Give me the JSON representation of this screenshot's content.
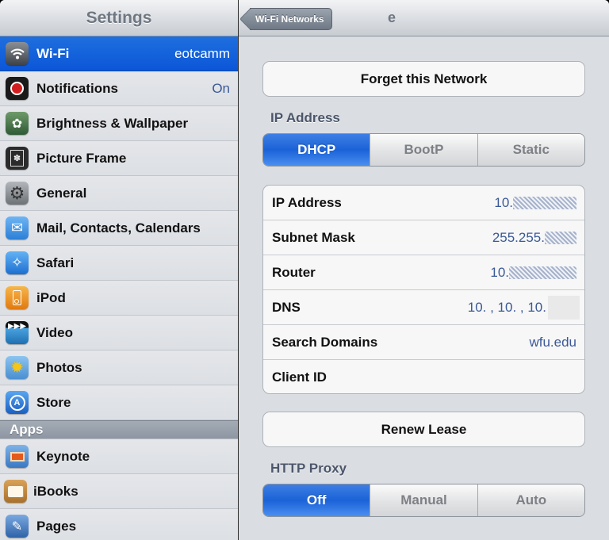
{
  "sidebar": {
    "title": "Settings",
    "items": [
      {
        "label": "Wi-Fi",
        "value": "eotcamm",
        "icon": "wifi-icon",
        "selected": true
      },
      {
        "label": "Notifications",
        "value": "On",
        "icon": "notifications-icon"
      },
      {
        "label": "Brightness & Wallpaper",
        "icon": "brightness-wallpaper-icon"
      },
      {
        "label": "Picture Frame",
        "icon": "picture-frame-icon"
      },
      {
        "label": "General",
        "icon": "gear-icon"
      },
      {
        "label": "Mail, Contacts, Calendars",
        "icon": "mail-icon"
      },
      {
        "label": "Safari",
        "icon": "safari-compass-icon"
      },
      {
        "label": "iPod",
        "icon": "ipod-icon"
      },
      {
        "label": "Video",
        "icon": "video-clapper-icon"
      },
      {
        "label": "Photos",
        "icon": "photos-sunflower-icon"
      },
      {
        "label": "Store",
        "icon": "app-store-icon"
      }
    ],
    "apps_header": "Apps",
    "apps": [
      {
        "label": "Keynote",
        "icon": "keynote-icon"
      },
      {
        "label": "iBooks",
        "icon": "ibooks-icon"
      },
      {
        "label": "Pages",
        "icon": "pages-icon"
      }
    ]
  },
  "detail": {
    "back_label": "Wi-Fi Networks",
    "title": "e",
    "forget_button": "Forget this Network",
    "ip_section_label": "IP Address",
    "ip_modes": [
      "DHCP",
      "BootP",
      "Static"
    ],
    "ip_mode_selected": "DHCP",
    "info_rows": [
      {
        "label": "IP Address",
        "value": "10."
      },
      {
        "label": "Subnet Mask",
        "value": "255.255."
      },
      {
        "label": "Router",
        "value": "10."
      },
      {
        "label": "DNS",
        "value": "10.   , 10.   , 10."
      },
      {
        "label": "Search Domains",
        "value": "wfu.edu"
      },
      {
        "label": "Client ID",
        "value": ""
      }
    ],
    "renew_button": "Renew Lease",
    "proxy_section_label": "HTTP Proxy",
    "proxy_modes": [
      "Off",
      "Manual",
      "Auto"
    ],
    "proxy_mode_selected": "Off"
  },
  "colors": {
    "selection_blue": "#1b62d8",
    "value_blue": "#3b5998"
  }
}
